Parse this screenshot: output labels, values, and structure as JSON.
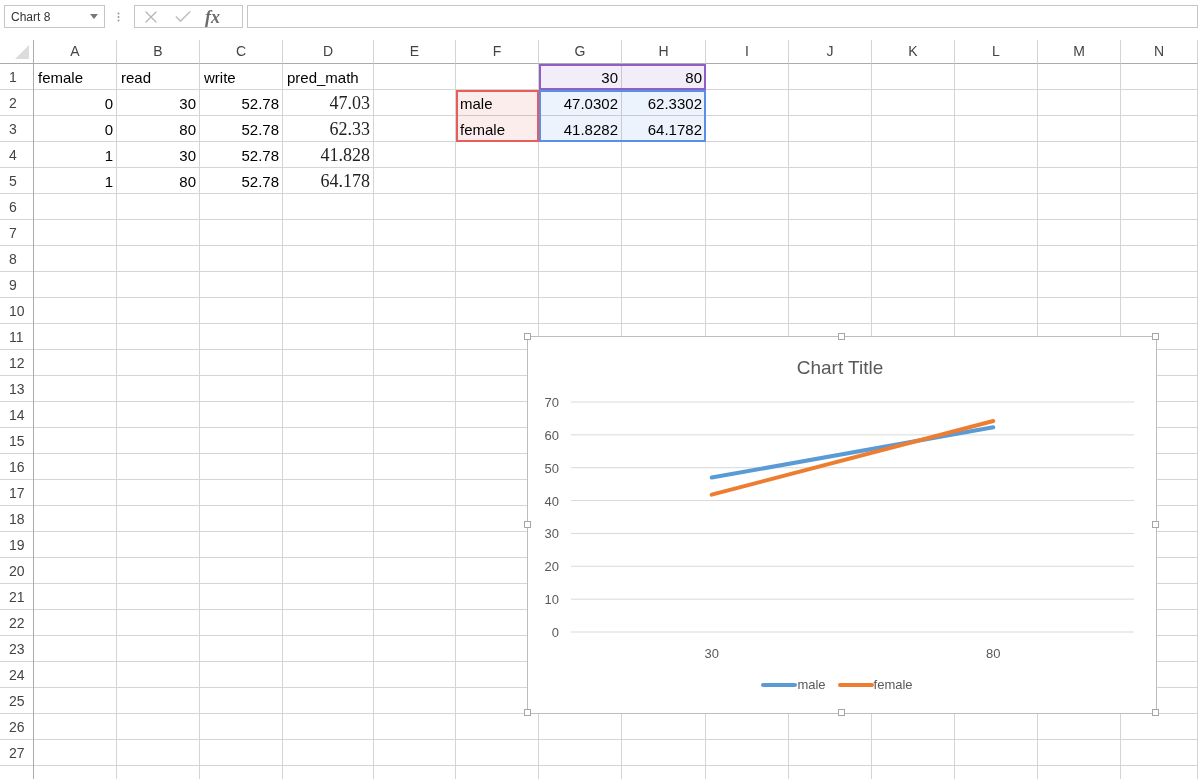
{
  "name_box": {
    "value": "Chart 8"
  },
  "formula_bar": {
    "fx_label": "fx"
  },
  "columns": [
    "A",
    "B",
    "C",
    "D",
    "E",
    "F",
    "G",
    "H",
    "I",
    "J",
    "K",
    "L",
    "M",
    "N"
  ],
  "rows": [
    {
      "number": "1",
      "cells": [
        {
          "text": "female",
          "kind": "text"
        },
        {
          "text": "read",
          "kind": "text"
        },
        {
          "text": "write",
          "kind": "text"
        },
        {
          "text": "pred_math",
          "kind": "text"
        },
        null,
        null,
        {
          "text": "30",
          "kind": "number",
          "color": "#8e5fc5"
        },
        {
          "text": "80",
          "kind": "number",
          "color": "#8e5fc5"
        }
      ]
    },
    {
      "number": "2",
      "cells": [
        {
          "text": "0",
          "kind": "number"
        },
        {
          "text": "30",
          "kind": "number"
        },
        {
          "text": "52.78",
          "kind": "number"
        },
        {
          "text": "47.03",
          "kind": "number"
        },
        null,
        {
          "text": "male",
          "kind": "text",
          "color": "#e85c5c"
        },
        {
          "text": "47.0302",
          "kind": "number",
          "color": "#5b8ee6"
        },
        {
          "text": "62.3302",
          "kind": "number",
          "color": "#5b8ee6"
        }
      ]
    },
    {
      "number": "3",
      "cells": [
        {
          "text": "0",
          "kind": "number"
        },
        {
          "text": "80",
          "kind": "number"
        },
        {
          "text": "52.78",
          "kind": "number"
        },
        {
          "text": "62.33",
          "kind": "number"
        },
        null,
        {
          "text": "female",
          "kind": "text",
          "color": "#e85c5c"
        },
        {
          "text": "41.8282",
          "kind": "number",
          "color": "#5b8ee6"
        },
        {
          "text": "64.1782",
          "kind": "number",
          "color": "#5b8ee6"
        }
      ]
    },
    {
      "number": "4",
      "cells": [
        {
          "text": "1",
          "kind": "number"
        },
        {
          "text": "30",
          "kind": "number"
        },
        {
          "text": "52.78",
          "kind": "number"
        },
        {
          "text": "41.828",
          "kind": "number"
        }
      ]
    },
    {
      "number": "5",
      "cells": [
        {
          "text": "1",
          "kind": "number"
        },
        {
          "text": "80",
          "kind": "number"
        },
        {
          "text": "52.78",
          "kind": "number"
        },
        {
          "text": "64.178",
          "kind": "number"
        }
      ]
    },
    {
      "number": "6"
    },
    {
      "number": "7"
    },
    {
      "number": "8"
    },
    {
      "number": "9"
    },
    {
      "number": "10"
    },
    {
      "number": "11"
    },
    {
      "number": "12"
    },
    {
      "number": "13"
    },
    {
      "number": "14"
    },
    {
      "number": "15"
    },
    {
      "number": "16"
    },
    {
      "number": "17"
    },
    {
      "number": "18"
    },
    {
      "number": "19"
    },
    {
      "number": "20"
    },
    {
      "number": "21"
    },
    {
      "number": "22"
    },
    {
      "number": "23"
    },
    {
      "number": "24"
    },
    {
      "number": "25"
    },
    {
      "number": "26"
    },
    {
      "number": "27"
    }
  ],
  "chart": {
    "chart_data": {
      "type": "line",
      "title": "Chart Title",
      "categories": [
        "30",
        "80"
      ],
      "series": [
        {
          "name": "male",
          "color": "#5b9bd5",
          "values": [
            47.0,
            62.3
          ]
        },
        {
          "name": "female",
          "color": "#ed7d31",
          "values": [
            41.8,
            64.2
          ]
        }
      ],
      "ylim": [
        0,
        70
      ],
      "yticks": [
        0,
        10,
        20,
        30,
        40,
        50,
        60,
        70
      ],
      "grid": true,
      "legend": true
    }
  }
}
